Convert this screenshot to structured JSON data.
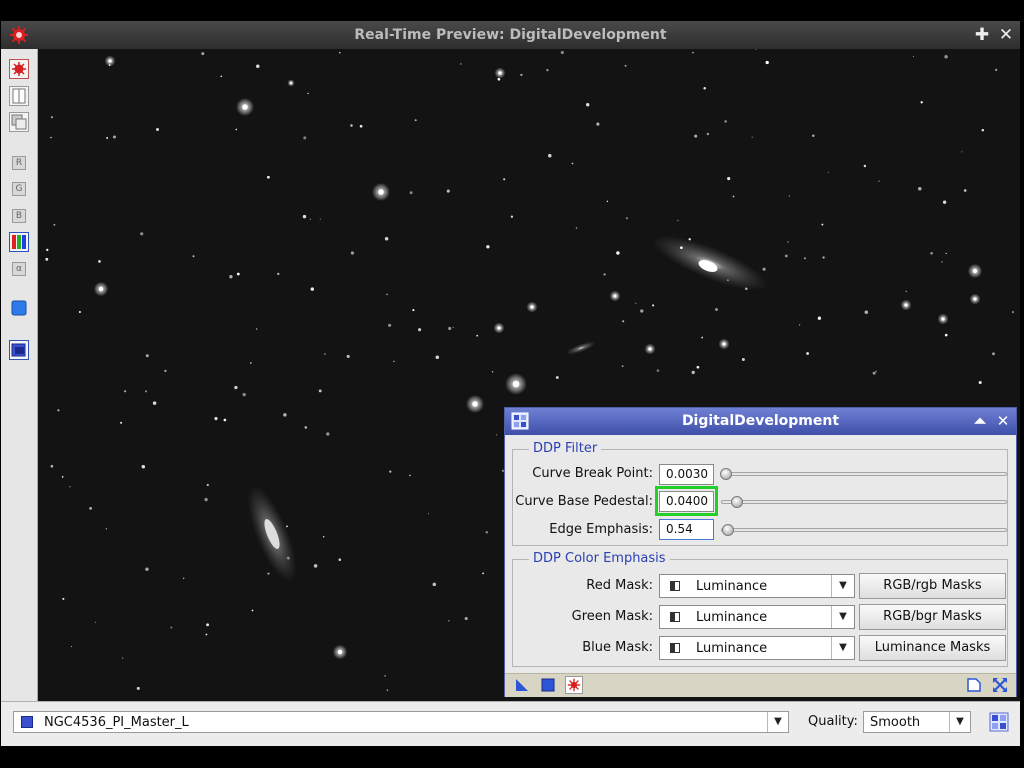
{
  "window": {
    "title": "Real-Time Preview: DigitalDevelopment",
    "pin_glyph": "✚",
    "close_glyph": "✕"
  },
  "left_toolbar": {
    "channel_r": "R",
    "channel_g": "G",
    "channel_b": "B",
    "channel_alpha": "α"
  },
  "bottom_bar": {
    "view_name": "NGC4536_PI_Master_L",
    "quality_label": "Quality:",
    "quality_value": "Smooth",
    "arrow_glyph": "▼"
  },
  "dialog": {
    "title": "DigitalDevelopment",
    "collapse_glyph": "⏶",
    "close_glyph": "✕",
    "ddp_filter": {
      "title": "DDP Filter",
      "rows": [
        {
          "label": "Curve Break Point:",
          "value": "0.0030",
          "slider_fraction": 0.0
        },
        {
          "label": "Curve Base Pedestal:",
          "value": "0.0400",
          "slider_fraction": 0.04
        },
        {
          "label": "Edge Emphasis:",
          "value": "0.54",
          "slider_fraction": 0.01
        }
      ]
    },
    "color_emphasis": {
      "title": "DDP Color Emphasis",
      "rows": [
        {
          "label": "Red Mask:",
          "value": "Luminance",
          "button": "RGB/rgb Masks"
        },
        {
          "label": "Green Mask:",
          "value": "Luminance",
          "button": "RGB/bgr Masks"
        },
        {
          "label": "Blue Mask:",
          "value": "Luminance",
          "button": "Luminance Masks"
        }
      ],
      "arrow_glyph": "▼"
    }
  },
  "colors": {
    "highlight": "#23d02a",
    "dialog_title": "#4a5bb8",
    "group_title": "#2a3fb2"
  }
}
